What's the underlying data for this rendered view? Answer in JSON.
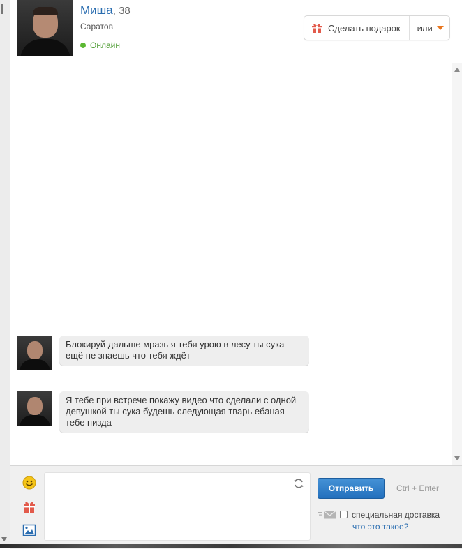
{
  "profile": {
    "name": "Миша",
    "age": "38",
    "city": "Саратов",
    "status": "Онлайн",
    "status_color": "#4a9a2e"
  },
  "header_actions": {
    "gift_button": "Сделать подарок",
    "more_button": "или",
    "gift_icon": "gift-icon",
    "caret_icon": "chevron-down-icon",
    "accent_color": "#e8761f"
  },
  "messages": [
    {
      "text": "Блокируй дальше мразь я тебя урою в лесу ты сука ещё не знаешь что тебя ждёт"
    },
    {
      "text": "Я тебе при встрече покажу видео что сделали с одной девушкой ты сука будешь следующая тварь ебаная тебе пизда"
    }
  ],
  "compose": {
    "send_button": "Отправить",
    "shortcut": "Ctrl + Enter",
    "special_delivery": "специальная доставка",
    "what_is_it": "что это такое?",
    "brand_color": "#2a6db0"
  }
}
